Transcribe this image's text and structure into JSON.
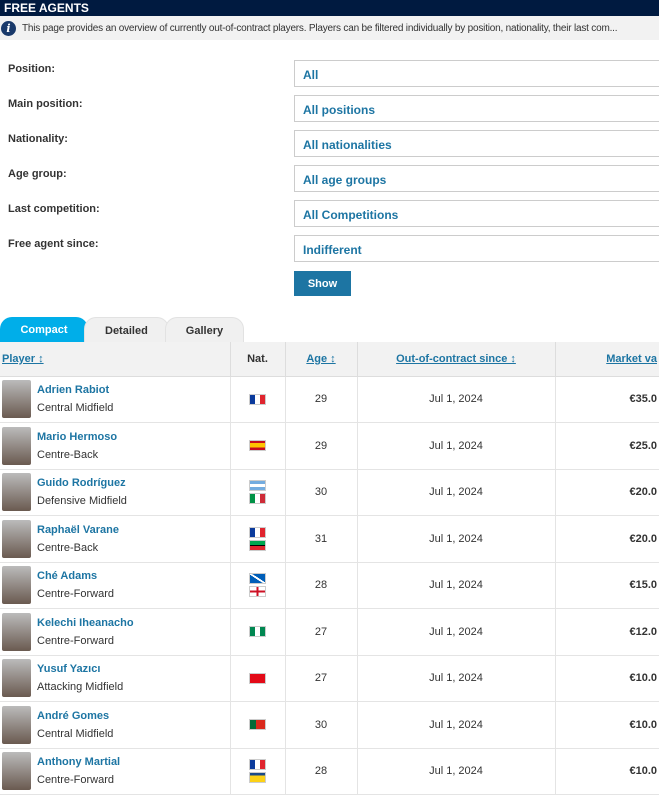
{
  "header": {
    "title": "FREE AGENTS",
    "info_text": "This page provides an overview of currently out-of-contract players. Players can be filtered individually by position, nationality, their last com..."
  },
  "filters": [
    {
      "label": "Position:",
      "value": "All"
    },
    {
      "label": "Main position:",
      "value": "All positions"
    },
    {
      "label": "Nationality:",
      "value": "All nationalities"
    },
    {
      "label": "Age group:",
      "value": "All age groups"
    },
    {
      "label": "Last competition:",
      "value": "All Competitions"
    },
    {
      "label": "Free agent since:",
      "value": "Indifferent"
    }
  ],
  "show_label": "Show",
  "tabs": [
    {
      "label": "Compact",
      "active": true
    },
    {
      "label": "Detailed"
    },
    {
      "label": "Gallery"
    }
  ],
  "columns": {
    "player": "Player ↕",
    "nat": "Nat.",
    "age": "Age ↕",
    "since": "Out-of-contract since ↕",
    "market": "Market va"
  },
  "players": [
    {
      "name": "Adrien Rabiot",
      "position": "Central Midfield",
      "flags": [
        "france"
      ],
      "age": "29",
      "since": "Jul 1, 2024",
      "value": "€35.0"
    },
    {
      "name": "Mario Hermoso",
      "position": "Centre-Back",
      "flags": [
        "spain"
      ],
      "age": "29",
      "since": "Jul 1, 2024",
      "value": "€25.0"
    },
    {
      "name": "Guido Rodríguez",
      "position": "Defensive Midfield",
      "flags": [
        "argentina",
        "italy"
      ],
      "age": "30",
      "since": "Jul 1, 2024",
      "value": "€20.0"
    },
    {
      "name": "Raphaël Varane",
      "position": "Centre-Back",
      "flags": [
        "france",
        "martinique"
      ],
      "age": "31",
      "since": "Jul 1, 2024",
      "value": "€20.0"
    },
    {
      "name": "Ché Adams",
      "position": "Centre-Forward",
      "flags": [
        "scotland",
        "england"
      ],
      "age": "28",
      "since": "Jul 1, 2024",
      "value": "€15.0"
    },
    {
      "name": "Kelechi Iheanacho",
      "position": "Centre-Forward",
      "flags": [
        "nigeria"
      ],
      "age": "27",
      "since": "Jul 1, 2024",
      "value": "€12.0"
    },
    {
      "name": "Yusuf Yazıcı",
      "position": "Attacking Midfield",
      "flags": [
        "turkey"
      ],
      "age": "27",
      "since": "Jul 1, 2024",
      "value": "€10.0"
    },
    {
      "name": "André Gomes",
      "position": "Central Midfield",
      "flags": [
        "portugal"
      ],
      "age": "30",
      "since": "Jul 1, 2024",
      "value": "€10.0"
    },
    {
      "name": "Anthony Martial",
      "position": "Centre-Forward",
      "flags": [
        "france",
        "guadeloupe"
      ],
      "age": "28",
      "since": "Jul 1, 2024",
      "value": "€10.0"
    }
  ],
  "colors": {
    "brand": "#001a40",
    "link": "#1d75a3",
    "tab_active": "#00aee9"
  }
}
